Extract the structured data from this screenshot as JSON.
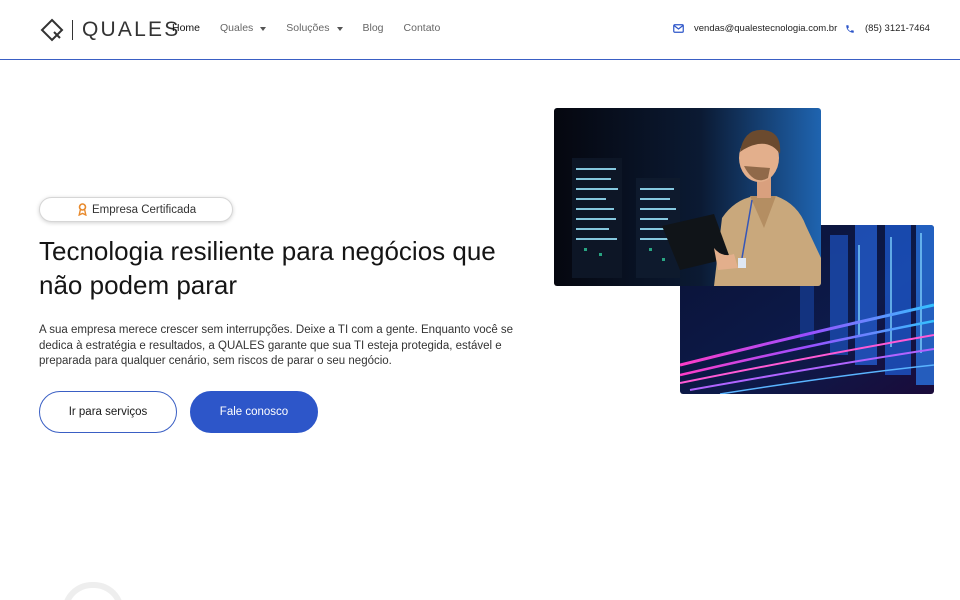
{
  "header": {
    "logo_text": "QUALES",
    "nav": [
      {
        "label": "Home"
      },
      {
        "label": "Quales"
      },
      {
        "label": "Soluções"
      },
      {
        "label": "Blog"
      },
      {
        "label": "Contato"
      }
    ],
    "email": "vendas@qualestecnologia.com.br",
    "phone": "(85) 3121-7464"
  },
  "hero": {
    "badge": "Empresa Certificada",
    "title": "Tecnologia resiliente para negócios que não podem parar",
    "description": "A sua empresa merece crescer sem interrupções. Deixe a TI com a gente. Enquanto você se dedica à estratégia e resultados, a QUALES garante que sua TI esteja protegida, estável e preparada para qualquer cenário, sem riscos de parar o seu negócio.",
    "btn_services": "Ir para serviços",
    "btn_contact": "Fale conosco"
  },
  "colors": {
    "accent": "#2d56c9",
    "border": "#3a5fc4",
    "badge_icon": "#e8892b"
  },
  "icons": {
    "logo": "diamond-logo-icon",
    "email": "mail-icon",
    "phone": "phone-icon",
    "badge": "award-ribbon-icon"
  }
}
